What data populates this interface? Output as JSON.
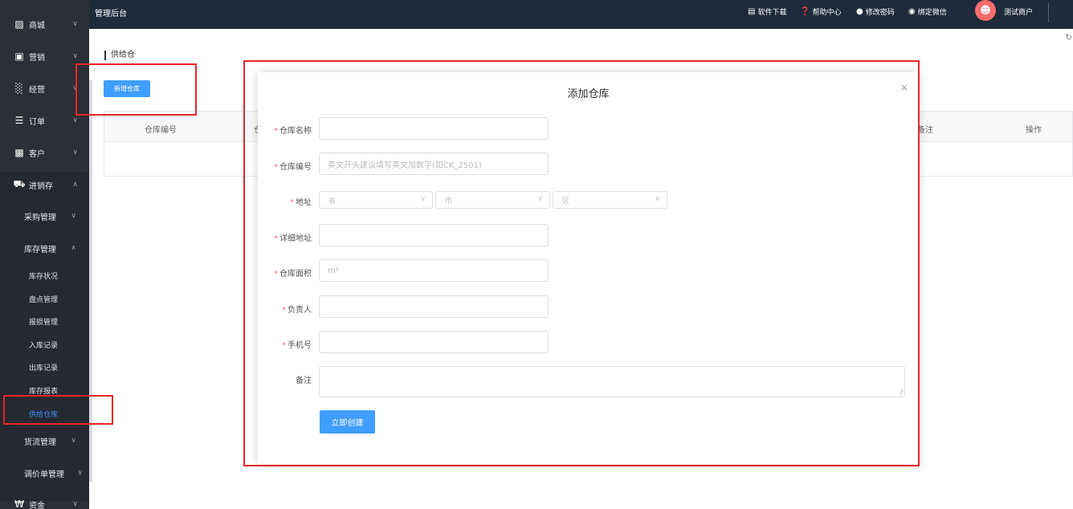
{
  "topbar": {
    "title": "管理后台",
    "links": [
      {
        "icon": "download-icon",
        "label": "软件下载"
      },
      {
        "icon": "help-icon",
        "label": "帮助中心"
      },
      {
        "icon": "lock-icon",
        "label": "修改密码"
      },
      {
        "icon": "wechat-icon",
        "label": "绑定微信"
      }
    ],
    "user": "测试商户"
  },
  "sidebar": {
    "items": [
      {
        "label": "商城",
        "icon": "shop-icon"
      },
      {
        "label": "营销",
        "icon": "gift-icon"
      },
      {
        "label": "经营",
        "icon": "bar-chart-icon"
      },
      {
        "label": "订单",
        "icon": "list-icon"
      },
      {
        "label": "客户",
        "icon": "contact-card-icon"
      },
      {
        "label": "进销存",
        "icon": "truck-icon"
      }
    ],
    "groups": [
      {
        "label": "采购管理"
      },
      {
        "label": "库存管理"
      }
    ],
    "leaves": [
      "库存状况",
      "盘点管理",
      "报损管理",
      "入库记录",
      "出库记录",
      "库存报表",
      "供给仓库"
    ],
    "after_groups": [
      {
        "label": "货流管理"
      },
      {
        "label": "调价单管理"
      }
    ],
    "bottom": {
      "label": "资金",
      "icon": "yuan-icon"
    }
  },
  "main": {
    "breadcrumb": "供给仓",
    "new_button": "新增仓库",
    "table_headers": [
      "仓库编号",
      "仓",
      "备注",
      "操作"
    ]
  },
  "dialog": {
    "title": "添加仓库",
    "close": "×",
    "fields": [
      {
        "label": "仓库名称",
        "placeholder": ""
      },
      {
        "label": "仓库编号",
        "placeholder": "英文开头建议填写英文加数字(如CK_2501)"
      },
      {
        "label": "地址"
      },
      {
        "label": "详细地址",
        "placeholder": ""
      },
      {
        "label": "仓库面积",
        "placeholder": "m²"
      },
      {
        "label": "负责人",
        "placeholder": ""
      },
      {
        "label": "手机号",
        "placeholder": ""
      },
      {
        "label": "备注"
      }
    ],
    "address_selects": [
      "省",
      "市",
      "区"
    ],
    "submit": "立即创建"
  },
  "colors": {
    "sidebar_bg": "#2b2f36",
    "topbar_bg": "#1f2a3d",
    "accent": "#409eff",
    "annotation_red": "#e8262b"
  }
}
